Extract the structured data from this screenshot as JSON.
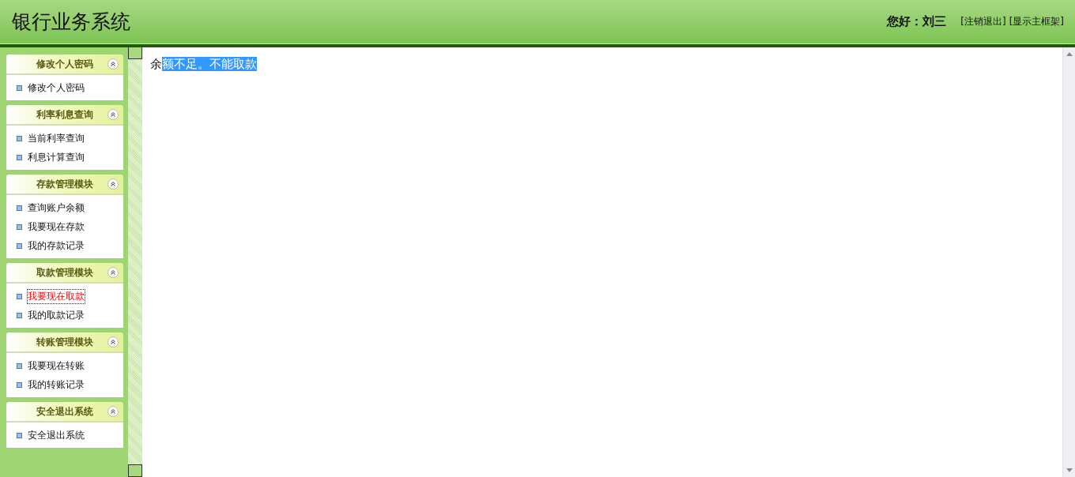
{
  "header": {
    "title": "银行业务系统",
    "greeting": "您好：刘三",
    "links": [
      "[注销退出]",
      "[显示主框架]"
    ]
  },
  "sidebar": {
    "groups": [
      {
        "title": "修改个人密码",
        "expanded": true,
        "items": [
          {
            "label": "修改个人密码",
            "selected": false
          }
        ]
      },
      {
        "title": "利率利息查询",
        "expanded": true,
        "items": [
          {
            "label": "当前利率查询",
            "selected": false
          },
          {
            "label": "利息计算查询",
            "selected": false
          }
        ]
      },
      {
        "title": "存款管理模块",
        "expanded": true,
        "items": [
          {
            "label": "查询账户余额",
            "selected": false
          },
          {
            "label": "我要现在存款",
            "selected": false
          },
          {
            "label": "我的存款记录",
            "selected": false
          }
        ]
      },
      {
        "title": "取款管理模块",
        "expanded": true,
        "items": [
          {
            "label": "我要现在取款",
            "selected": true
          },
          {
            "label": "我的取款记录",
            "selected": false
          }
        ]
      },
      {
        "title": "转账管理模块",
        "expanded": true,
        "items": [
          {
            "label": "我要现在转账",
            "selected": false
          },
          {
            "label": "我的转账记录",
            "selected": false
          }
        ]
      },
      {
        "title": "安全退出系统",
        "expanded": true,
        "items": [
          {
            "label": "安全退出系统",
            "selected": false
          }
        ]
      }
    ]
  },
  "content": {
    "message": [
      {
        "text": "余",
        "selected": false
      },
      {
        "text": "额不足。不能取款 ",
        "selected": true
      }
    ]
  }
}
